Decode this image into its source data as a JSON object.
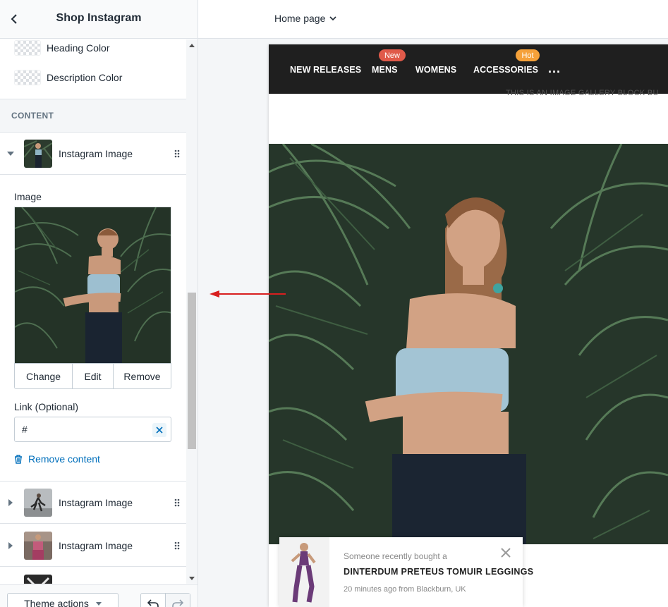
{
  "sidebar": {
    "title": "Shop Instagram",
    "color_settings": [
      {
        "label": "Heading Color"
      },
      {
        "label": "Description Color"
      }
    ],
    "section_heading": "CONTENT",
    "expanded_block": {
      "label": "Instagram Image",
      "image_label": "Image",
      "buttons": {
        "change": "Change",
        "edit": "Edit",
        "remove": "Remove"
      },
      "link_label": "Link (Optional)",
      "link_value": "#",
      "remove_content": "Remove content"
    },
    "blocks": [
      {
        "label": "Instagram Image"
      },
      {
        "label": "Instagram Image"
      }
    ],
    "footer": {
      "theme_actions": "Theme actions"
    }
  },
  "topbar": {
    "page_select": "Home page"
  },
  "store_preview": {
    "nav_items": [
      {
        "label": "NEW RELEASES"
      },
      {
        "label": "MENS",
        "badge": "New",
        "badge_color": "#e05a4a"
      },
      {
        "label": "WOMENS"
      },
      {
        "label": "ACCESSORIES",
        "badge": "Hot",
        "badge_color": "#f5a13a"
      }
    ],
    "nav_more": "...",
    "cut_text": "THIS IS AN IMAGE GALLERY BLOCK BU",
    "toast": {
      "pre": "Someone recently bought a",
      "product": "DINTERDUM PRETEUS TOMUIR LEGGINGS",
      "meta": "20 minutes ago from Blackburn, UK"
    }
  }
}
